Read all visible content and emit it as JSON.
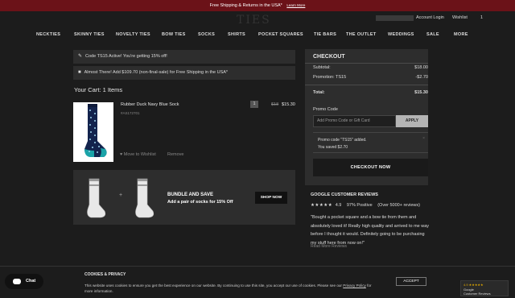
{
  "promo_bar": {
    "text": "Free Shipping & Returns in the USA*",
    "link": "Learn More"
  },
  "header": {
    "logo": "TIES",
    "account": "Account Login",
    "wishlist": "Wishlist",
    "cart_count": "1"
  },
  "nav": {
    "items": [
      "NECKTIES",
      "SKINNY TIES",
      "NOVELTY TIES",
      "BOW TIES",
      "SOCKS",
      "SHIRTS",
      "POCKET SQUARES",
      "TIE BARS",
      "THE OUTLET",
      "WEDDINGS",
      "SALE",
      "MORE"
    ]
  },
  "notices": [
    {
      "icon": "tag-icon",
      "text": "Code TS15 Active! You're getting 15% off!"
    },
    {
      "icon": "truck-icon",
      "text": "Almost There! Add $109.70 (non-final-sale) for Free Shipping in the USA*"
    }
  ],
  "cart": {
    "title": "Your Cart: 1 Items",
    "item": {
      "name": "Rubber Duck Navy Blue Sock",
      "sku": "#AS172701",
      "qty": "1",
      "old_price": "$18",
      "new_price": "$15.30",
      "wishlist_label": "Move to Wishlist",
      "remove_label": "Remove"
    }
  },
  "bundle": {
    "title": "BUNDLE AND SAVE",
    "subtitle": "Add a pair of socks for 15% Off",
    "button": "SHOP NOW"
  },
  "checkout": {
    "title": "CHECKOUT",
    "subtotal_label": "Subtotal:",
    "subtotal": "$18.00",
    "promo_label": "Promotion: TS15",
    "promo": "-$2.70",
    "total_label": "Total:",
    "total": "$15.30",
    "promo_code_label": "Promo Code",
    "input_placeholder": "Add Promo Code or Gift Card",
    "apply": "APPLY",
    "applied_line1": "Promo code \"TS15\" added.",
    "applied_line2": "You saved $2.70",
    "checkout_btn": "CHECKOUT NOW"
  },
  "reviews": {
    "title": "GOOGLE CUSTOMER REVIEWS",
    "stars": "★★★★★",
    "score": "4.9",
    "positive": "97% Positive",
    "count": "(Over 5000+ reviews)",
    "quote": "\"Bought a pocket square and a bow tie from them and absolutely loved it! Really high quality and arrived to me way before I thought it would. Definitely going to be purchasing my stuff here from now on!\"",
    "read_more": "Read More Reviews"
  },
  "cookie": {
    "title": "COOKIES & PRIVACY",
    "text": "This website uses cookies to ensure you get the best experience on our website. By continuing to use this site, you accept our use of cookies. Please see our",
    "link": "Privacy Policy",
    "text_end": "for more information.",
    "accept": "ACCEPT"
  },
  "chat": {
    "label": "Chat"
  },
  "google_badge": {
    "rating": "4.9 ★★★★★",
    "line1": "Google",
    "line2": "Customer Reviews"
  }
}
